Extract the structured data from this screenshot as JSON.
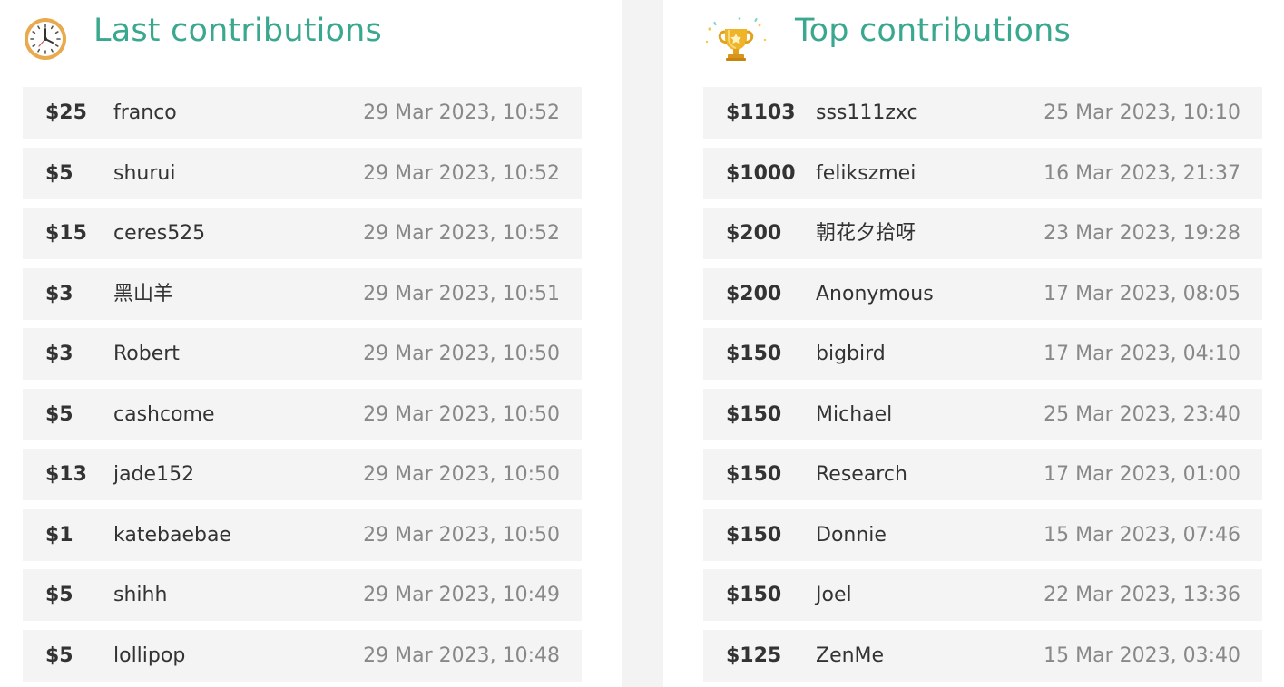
{
  "colors": {
    "title": "#3aa88f",
    "row_bg": "#f4f4f4",
    "amount": "#333333",
    "date": "#888888"
  },
  "last": {
    "title": "Last contributions",
    "icon": "clock-icon",
    "rows": [
      {
        "amount": "$25",
        "user": "franco",
        "date": "29 Mar 2023, 10:52"
      },
      {
        "amount": "$5",
        "user": "shurui",
        "date": "29 Mar 2023, 10:52"
      },
      {
        "amount": "$15",
        "user": "ceres525",
        "date": "29 Mar 2023, 10:52"
      },
      {
        "amount": "$3",
        "user": "黑山羊",
        "date": "29 Mar 2023, 10:51"
      },
      {
        "amount": "$3",
        "user": "Robert",
        "date": "29 Mar 2023, 10:50"
      },
      {
        "amount": "$5",
        "user": "cashcome",
        "date": "29 Mar 2023, 10:50"
      },
      {
        "amount": "$13",
        "user": "jade152",
        "date": "29 Mar 2023, 10:50"
      },
      {
        "amount": "$1",
        "user": "katebaebae",
        "date": "29 Mar 2023, 10:50"
      },
      {
        "amount": "$5",
        "user": "shihh",
        "date": "29 Mar 2023, 10:49"
      },
      {
        "amount": "$5",
        "user": "lollipop",
        "date": "29 Mar 2023, 10:48"
      }
    ]
  },
  "top": {
    "title": "Top contributions",
    "icon": "trophy-icon",
    "rows": [
      {
        "amount": "$1103",
        "user": "sss111zxc",
        "date": "25 Mar 2023, 10:10"
      },
      {
        "amount": "$1000",
        "user": "felikszmei",
        "date": "16 Mar 2023, 21:37"
      },
      {
        "amount": "$200",
        "user": "朝花夕拾呀",
        "date": "23 Mar 2023, 19:28"
      },
      {
        "amount": "$200",
        "user": "Anonymous",
        "date": "17 Mar 2023, 08:05"
      },
      {
        "amount": "$150",
        "user": "bigbird",
        "date": "17 Mar 2023, 04:10"
      },
      {
        "amount": "$150",
        "user": "Michael",
        "date": "25 Mar 2023, 23:40"
      },
      {
        "amount": "$150",
        "user": "Research",
        "date": "17 Mar 2023, 01:00"
      },
      {
        "amount": "$150",
        "user": "Donnie",
        "date": "15 Mar 2023, 07:46"
      },
      {
        "amount": "$150",
        "user": "Joel",
        "date": "22 Mar 2023, 13:36"
      },
      {
        "amount": "$125",
        "user": "ZenMe",
        "date": "15 Mar 2023, 03:40"
      }
    ]
  }
}
